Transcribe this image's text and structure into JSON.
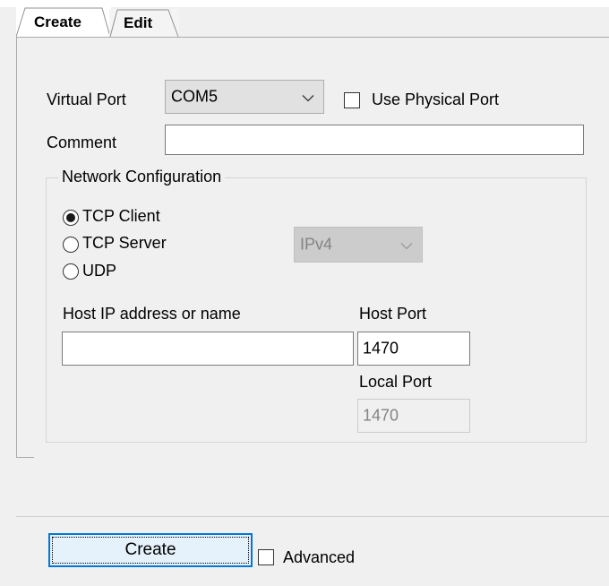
{
  "tabs": [
    {
      "label": "Create",
      "active": true
    },
    {
      "label": "Edit",
      "active": false
    }
  ],
  "virtual_port": {
    "label": "Virtual Port",
    "value": "COM5"
  },
  "use_physical_port": {
    "label": "Use Physical Port",
    "checked": false
  },
  "comment": {
    "label": "Comment",
    "value": ""
  },
  "network": {
    "title": "Network Configuration",
    "modes": [
      {
        "label": "TCP Client",
        "checked": true
      },
      {
        "label": "TCP Server",
        "checked": false
      },
      {
        "label": "UDP",
        "checked": false
      }
    ],
    "ip_version": {
      "value": "IPv4",
      "enabled": false
    },
    "host_ip": {
      "label": "Host IP address or name",
      "value": ""
    },
    "host_port": {
      "label": "Host Port",
      "value": "1470"
    },
    "local_port": {
      "label": "Local Port",
      "value": "1470",
      "enabled": false
    }
  },
  "footer": {
    "create_label": "Create",
    "advanced_label": "Advanced",
    "advanced_checked": false
  },
  "colors": {
    "background": "#f0f0f0",
    "accent": "#0078d7",
    "button_bg": "#e5f1fb",
    "disabled_text": "#838383"
  }
}
